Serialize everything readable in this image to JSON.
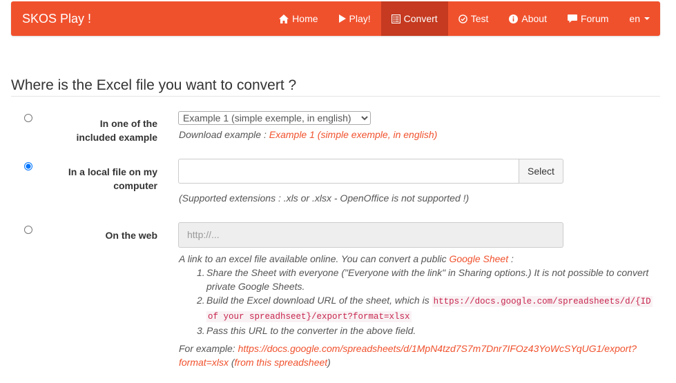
{
  "navbar": {
    "brand": "SKOS Play !",
    "items": [
      {
        "label": "Home",
        "icon": "home-icon",
        "active": false
      },
      {
        "label": "Play!",
        "icon": "play-icon",
        "active": false
      },
      {
        "label": "Convert",
        "icon": "list-icon",
        "active": true
      },
      {
        "label": "Test",
        "icon": "check-circle-icon",
        "active": false
      },
      {
        "label": "About",
        "icon": "info-icon",
        "active": false
      },
      {
        "label": "Forum",
        "icon": "comment-icon",
        "active": false
      }
    ],
    "language": "en"
  },
  "page": {
    "title": "Where is the Excel file you want to convert ?"
  },
  "options": {
    "example": {
      "label_line1": "In one of the",
      "label_line2": "included example",
      "selected": false,
      "select_value": "Example 1 (simple exemple, in english)",
      "download_prefix": "Download example : ",
      "download_link": "Example 1 (simple exemple, in english)"
    },
    "local": {
      "label_line1": "In a local file on my",
      "label_line2": "computer",
      "selected": true,
      "file_value": "",
      "button_label": "Select",
      "help": "(Supported extensions : .xls or .xlsx - OpenOffice is not supported !)"
    },
    "web": {
      "label": "On the web",
      "selected": false,
      "placeholder": "http://...",
      "intro_prefix": "A link to an excel file available online. You can convert a public ",
      "intro_link": "Google Sheet",
      "intro_suffix": " :",
      "steps": [
        {
          "num": "1.",
          "line1": "Share the Sheet with everyone (\"Everyone with the link\" in Sharing options.) It is not possible to convert",
          "line2": "private Google Sheets."
        },
        {
          "num": "2.",
          "text_prefix": "Build the Excel download URL of the sheet, which is ",
          "code1": "https://docs.google.com/spreadsheets/d/{ID",
          "code2": "of your spreadhseet}/export?format=xlsx"
        },
        {
          "num": "3.",
          "text": "Pass this URL to the converter in the above field."
        }
      ],
      "example_prefix": "For example: ",
      "example_link1": "https://docs.google.com/spreadsheets/d/1MpN4tzd7S7m7Dnr7IFOz43YoWcSYqUG1/export?",
      "example_link2": "format=xlsx",
      "example_paren_open": " (",
      "example_source_link": "from this spreadsheet",
      "example_paren_close": ")"
    }
  },
  "colors": {
    "brand": "#f0512d",
    "active_nav": "#c53a20"
  }
}
